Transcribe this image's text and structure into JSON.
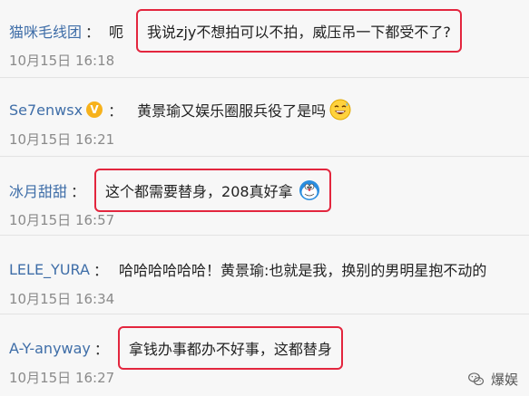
{
  "comments": [
    {
      "user": "猫咪毛线团",
      "separator": "：",
      "prefix": "呃",
      "text": "我说zjy不想拍可以不拍，威压吊一下都受不了?",
      "time": "10月15日 16:18"
    },
    {
      "user": "Se7enwsx",
      "separator": "：",
      "badge": "V",
      "text": "黄景瑜又娱乐圈服兵役了是吗",
      "emoji": "grinning-sweat-emoji",
      "time": "10月15日 16:21"
    },
    {
      "user": "冰月甜甜",
      "separator": "：",
      "text": "这个都需要替身，208真好拿",
      "emoji": "doraemon-emoji",
      "time": "10月15日 16:57"
    },
    {
      "user": "LELE_YURA",
      "separator": "：",
      "text": "哈哈哈哈哈哈！黄景瑜:也就是我，换别的男明星抱不动的",
      "time": "10月15日 16:34"
    },
    {
      "user": "A-Y-anyway",
      "separator": "：",
      "text": "拿钱办事都办不好事，这都替身",
      "time": "10月15日 16:27"
    }
  ],
  "watermark": {
    "text": "爆娱",
    "icon": "wechat-icon"
  },
  "colors": {
    "username": "#3f6ea8",
    "highlight": "#e3263e",
    "time": "#8a8a8a"
  }
}
